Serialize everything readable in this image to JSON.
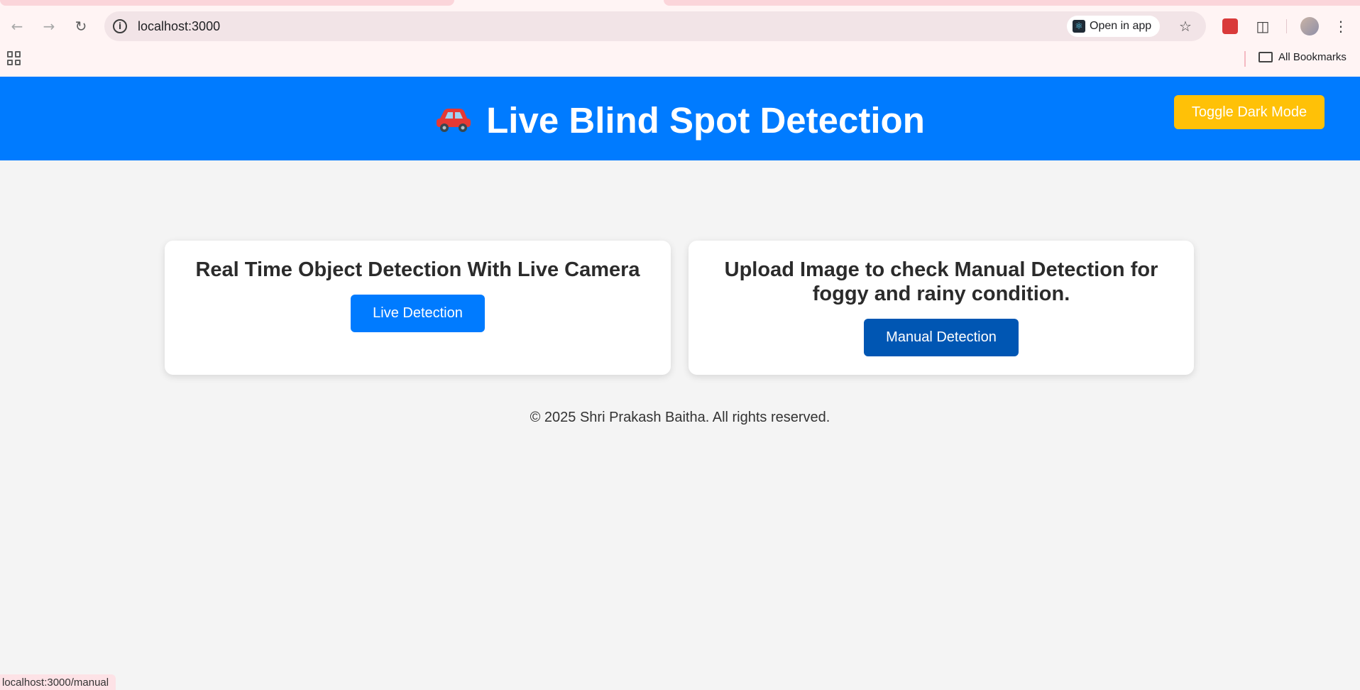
{
  "browser": {
    "url": "localhost:3000",
    "open_in_app": "Open in app",
    "bookmarks_label": "All Bookmarks",
    "status_url": "localhost:3000/manual"
  },
  "header": {
    "title": "Live Blind Spot Detection",
    "toggle_label": "Toggle Dark Mode"
  },
  "cards": [
    {
      "title": "Real Time Object Detection With Live Camera",
      "button": "Live Detection"
    },
    {
      "title_line1": "Upload Image to check Manual Detection for",
      "title_line2": "foggy and rainy condition.",
      "button": "Manual Detection"
    }
  ],
  "footer": {
    "text": "© 2025 Shri Prakash Baitha. All rights reserved."
  },
  "colors": {
    "header_bg": "#007bff",
    "toggle_bg": "#ffc107",
    "live_btn": "#007bff",
    "manual_btn": "#0056b3"
  }
}
